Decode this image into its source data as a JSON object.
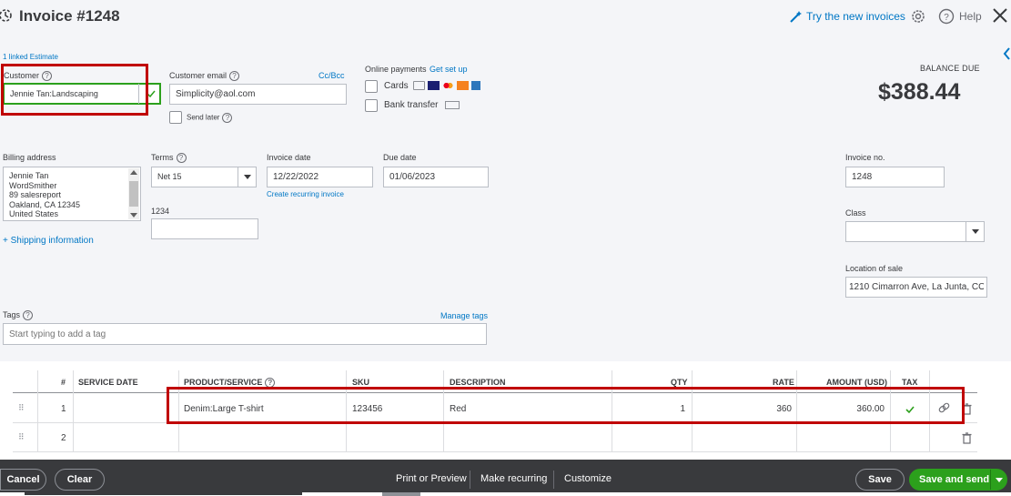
{
  "header": {
    "title": "Invoice #1248",
    "try_new": "Try the new invoices",
    "help": "Help"
  },
  "linked_estimate": "1 linked Estimate",
  "customer": {
    "label": "Customer",
    "value": "Jennie Tan:Landscaping"
  },
  "customer_email": {
    "label": "Customer email",
    "cc_bcc": "Cc/Bcc",
    "value": "Simplicity@aol.com",
    "send_later": "Send later"
  },
  "online_payments": {
    "label": "Online payments",
    "get_set_up": "Get set up",
    "cards": "Cards",
    "bank_transfer": "Bank transfer"
  },
  "balance": {
    "label": "BALANCE DUE",
    "amount": "$388.44"
  },
  "billing": {
    "label": "Billing address",
    "lines": [
      "Jennie Tan",
      "WordSmither",
      "89 salesreport",
      "Oakland, CA  12345",
      "United States"
    ]
  },
  "terms": {
    "label": "Terms",
    "value": "Net 15"
  },
  "invoice_date": {
    "label": "Invoice date",
    "value": "12/22/2022",
    "create_recurring": "Create recurring invoice"
  },
  "due_date": {
    "label": "Due date",
    "value": "01/06/2023"
  },
  "custom_field": {
    "label": "1234",
    "value": ""
  },
  "shipping_link": "+ Shipping information",
  "invoice_no": {
    "label": "Invoice no.",
    "value": "1248"
  },
  "class": {
    "label": "Class",
    "value": ""
  },
  "location": {
    "label": "Location of sale",
    "value": "1210 Cimarron Ave, La Junta, CO,"
  },
  "tags": {
    "label": "Tags",
    "manage": "Manage tags",
    "placeholder": "Start typing to add a tag"
  },
  "table": {
    "headers": {
      "num": "#",
      "service_date": "SERVICE DATE",
      "product": "PRODUCT/SERVICE",
      "sku": "SKU",
      "description": "DESCRIPTION",
      "qty": "QTY",
      "rate": "RATE",
      "amount": "AMOUNT (USD)",
      "tax": "TAX"
    },
    "rows": [
      {
        "num": "1",
        "service_date": "",
        "product": "Denim:Large T-shirt",
        "sku": "123456",
        "description": "Red",
        "qty": "1",
        "rate": "360",
        "amount": "360.00"
      },
      {
        "num": "2",
        "service_date": "",
        "product": "",
        "sku": "",
        "description": "",
        "qty": "",
        "rate": "",
        "amount": ""
      }
    ]
  },
  "footer": {
    "cancel": "Cancel",
    "clear": "Clear",
    "print_preview": "Print or Preview",
    "make_recurring": "Make recurring",
    "customize": "Customize",
    "save": "Save",
    "save_and_send": "Save and send"
  },
  "colors": {
    "accent_green": "#2ca01c",
    "link_blue": "#0077c5",
    "highlight_red": "#c00000",
    "footer_bg": "#393a3d"
  }
}
